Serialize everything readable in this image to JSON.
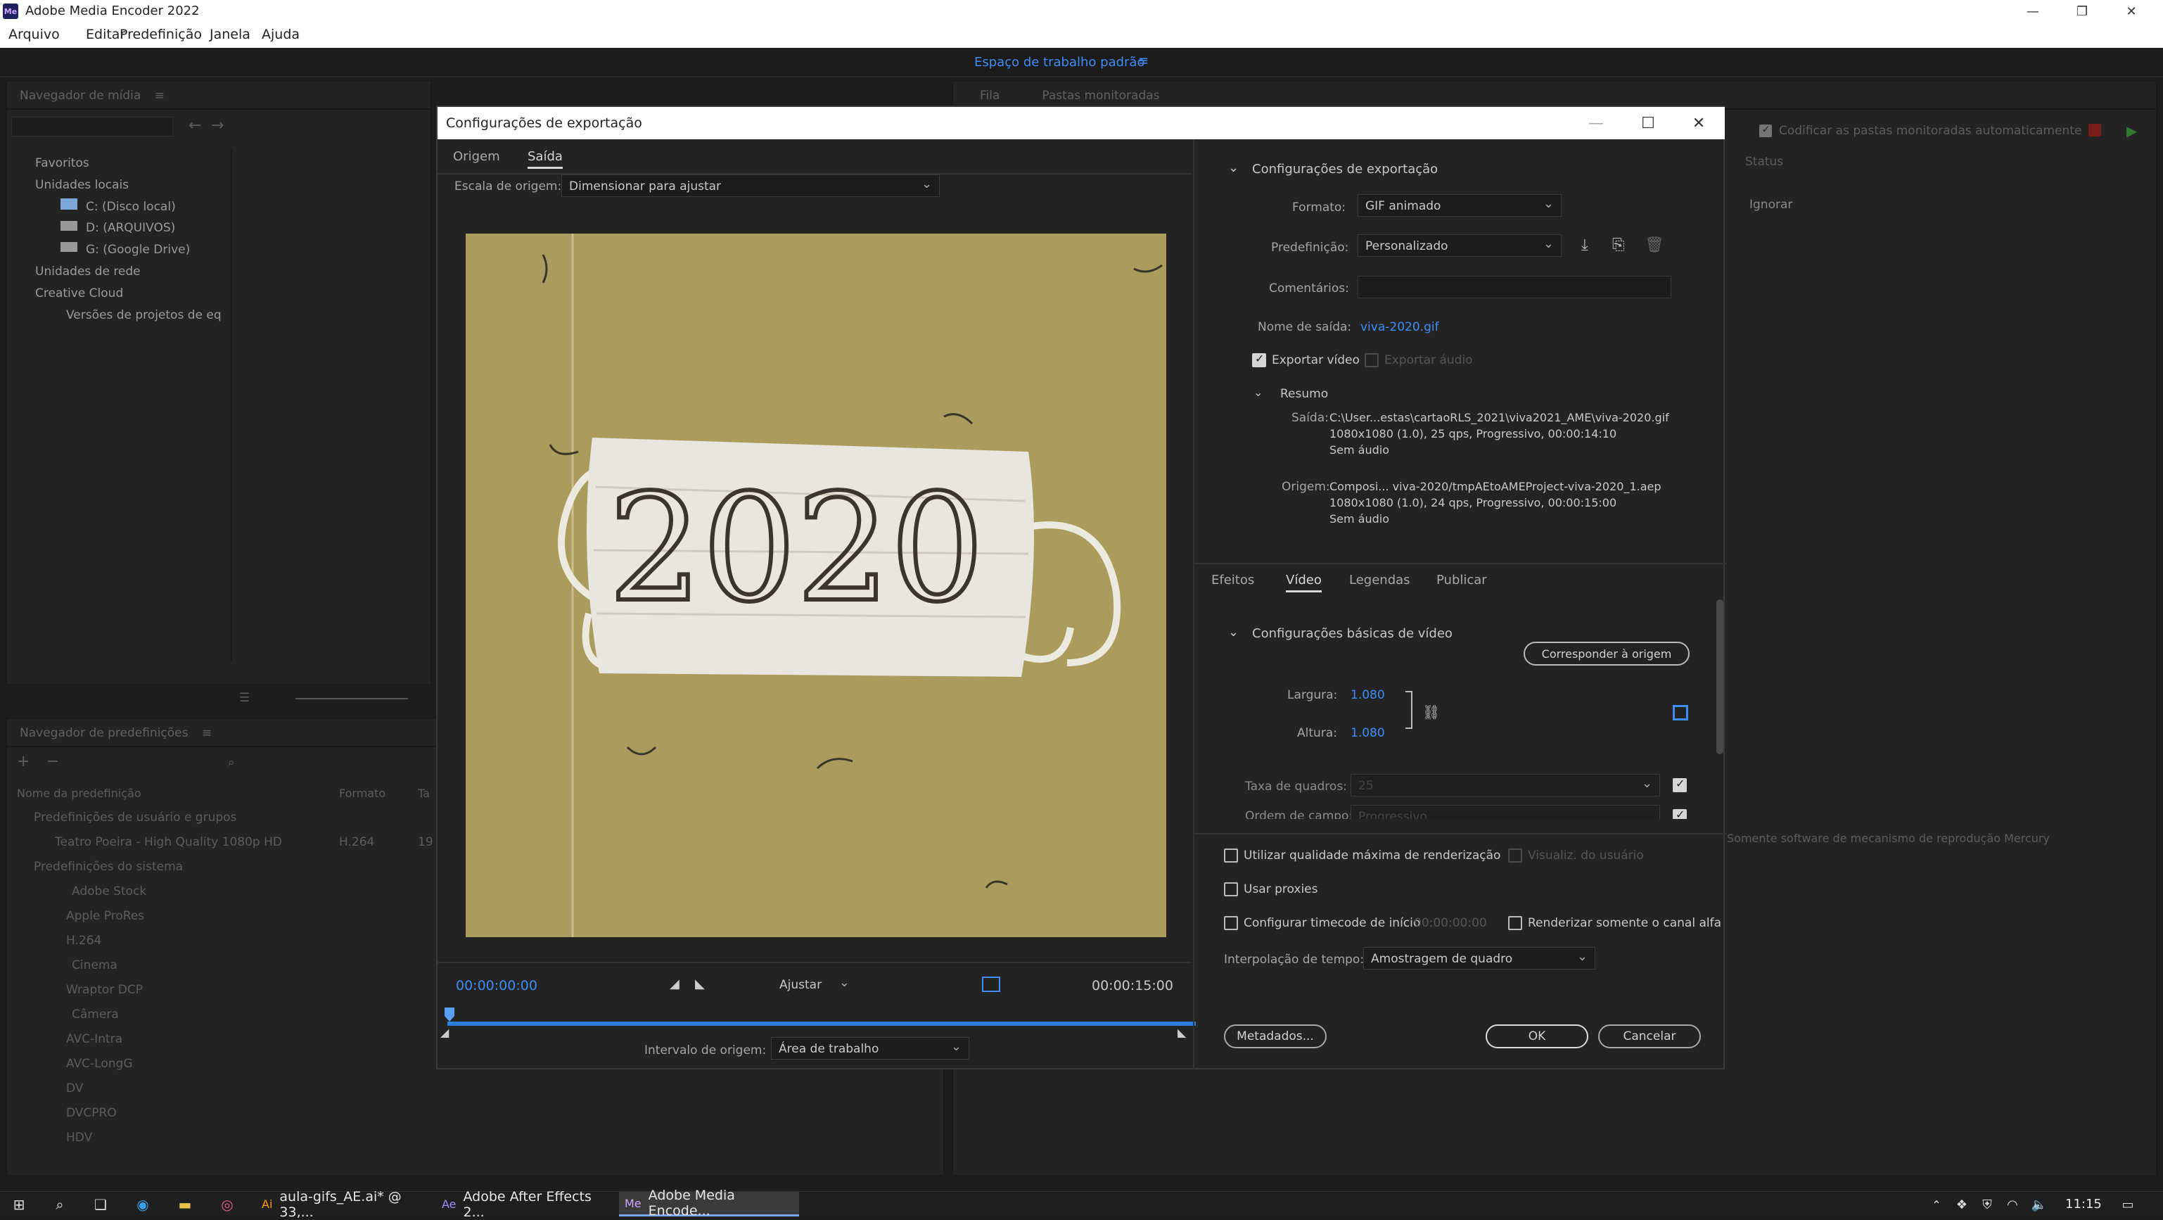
{
  "app": {
    "title": "Adobe Media Encoder 2022",
    "icon_label": "Me",
    "menu": [
      "Arquivo",
      "Editar",
      "Predefinição",
      "Janela",
      "Ajuda"
    ],
    "workspace": "Espaço de trabalho padrão"
  },
  "media_browser": {
    "title": "Navegador de mídia",
    "items": [
      {
        "label": "Favoritos"
      },
      {
        "label": "Unidades locais"
      },
      {
        "label": "C: (Disco local)"
      },
      {
        "label": "D: (ARQUIVOS)"
      },
      {
        "label": "G: (Google Drive)"
      },
      {
        "label": "Unidades de rede"
      },
      {
        "label": "Creative Cloud"
      },
      {
        "label": "Versões de projetos de eq"
      }
    ]
  },
  "preset_browser": {
    "title": "Navegador de predefinições",
    "columns": [
      "Nome da predefinição",
      "Formato",
      "Ta"
    ],
    "rows": [
      {
        "label": "Predefinições de usuário e grupos",
        "format": "",
        "extra": ""
      },
      {
        "label": "Teatro Poeira - High Quality 1080p HD",
        "format": "H.264",
        "extra": "19"
      },
      {
        "label": "Predefinições do sistema",
        "format": "",
        "extra": ""
      },
      {
        "label": "Adobe Stock",
        "format": "",
        "extra": ""
      },
      {
        "label": "Apple ProRes",
        "format": "",
        "extra": ""
      },
      {
        "label": "H.264",
        "format": "",
        "extra": ""
      },
      {
        "label": "Cinema",
        "format": "",
        "extra": ""
      },
      {
        "label": "Wraptor DCP",
        "format": "",
        "extra": ""
      },
      {
        "label": "Câmera",
        "format": "",
        "extra": ""
      },
      {
        "label": "AVC-Intra",
        "format": "",
        "extra": ""
      },
      {
        "label": "AVC-LongG",
        "format": "",
        "extra": ""
      },
      {
        "label": "DV",
        "format": "",
        "extra": ""
      },
      {
        "label": "DVCPRO",
        "format": "",
        "extra": ""
      },
      {
        "label": "HDV",
        "format": "",
        "extra": ""
      }
    ]
  },
  "queue": {
    "tab_fila": "Fila",
    "tab_pastas": "Pastas monitoradas",
    "auto_encode": "Codificar as pastas monitoradas automaticamente",
    "status_header": "Status",
    "status_value": "Ignorar",
    "renderer_text": "Somente software de mecanismo de reprodução Mercury"
  },
  "dialog": {
    "title": "Configurações de exportação",
    "tabs": [
      "Origem",
      "Saída"
    ],
    "source_scale_label": "Escala de origem:",
    "source_scale_value": "Dimensionar para ajustar",
    "preview_text": "2020",
    "timecode_start": "00:00:00:00",
    "timecode_end": "00:00:15:00",
    "fit_value": "Ajustar",
    "source_range_label": "Intervalo de origem:",
    "source_range_value": "Área de trabalho",
    "export_settings": {
      "header": "Configurações de exportação",
      "format_label": "Formato:",
      "format_value": "GIF animado",
      "preset_label": "Predefinição:",
      "preset_value": "Personalizado",
      "comments_label": "Comentários:",
      "output_name_label": "Nome de saída:",
      "output_name_value": "viva-2020.gif",
      "export_video": "Exportar vídeo",
      "export_audio": "Exportar áudio",
      "summary_header": "Resumo",
      "output_label": "Saída:",
      "output_lines": [
        "C:\\User...estas\\cartaoRLS_2021\\viva2021_AME\\viva-2020.gif",
        "1080x1080 (1.0), 25 qps, Progressivo, 00:00:14:10",
        "Sem áudio"
      ],
      "source_label": "Origem:",
      "source_lines": [
        "Composi... viva-2020/tmpAEtoAMEProject-viva-2020_1.aep",
        "1080x1080 (1.0), 24 qps, Progressivo, 00:00:15:00",
        "Sem áudio"
      ]
    },
    "settings_tabs": [
      "Efeitos",
      "Vídeo",
      "Legendas",
      "Publicar"
    ],
    "video": {
      "header": "Configurações básicas de vídeo",
      "match_source": "Corresponder à origem",
      "width_label": "Largura:",
      "width_value": "1.080",
      "height_label": "Altura:",
      "height_value": "1.080",
      "frame_rate_label": "Taxa de quadros:",
      "frame_rate_value": "25",
      "field_order_label": "Ordem de campo:",
      "field_order_value": "Progressivo"
    },
    "options": {
      "max_render": "Utilizar qualidade máxima de renderização",
      "user_preview": "Visualiz. do usuário",
      "use_proxies": "Usar proxies",
      "set_timecode": "Configurar timecode de início",
      "timecode_value": "00:00:00:00",
      "alpha_only": "Renderizar somente o canal alfa",
      "time_interp_label": "Interpolação de tempo:",
      "time_interp_value": "Amostragem de quadro"
    },
    "buttons": {
      "metadata": "Metadados...",
      "ok": "OK",
      "cancel": "Cancelar"
    }
  },
  "taskbar": {
    "apps": [
      {
        "label": "aula-gifs_AE.ai* @ 33,..."
      },
      {
        "label": "Adobe After Effects 2..."
      },
      {
        "label": "Adobe Media Encode..."
      }
    ],
    "time": "11:15"
  },
  "colors": {
    "accent": "#3d8df5",
    "background": "#232323",
    "preview_bg": "#a89a5a"
  }
}
